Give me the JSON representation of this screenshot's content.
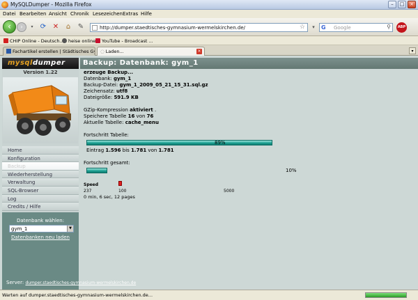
{
  "window": {
    "title": "MySQLDumper - Mozilla Firefox"
  },
  "menubar": [
    "Datei",
    "Bearbeiten",
    "Ansicht",
    "Chronik",
    "Lesezeichen",
    "Extras",
    "Hilfe"
  ],
  "navbar": {
    "url": "http://dumper.staedtisches-gymnasium-wermelskirchen.de/",
    "search_placeholder": "Google",
    "abp_label": "ABP"
  },
  "bookmarks": [
    {
      "label": "CHIP Online - Deutsch...",
      "color": "#d32020"
    },
    {
      "label": "heise online",
      "color": "#555555"
    },
    {
      "label": "YouTube - Broadcast ...",
      "color": "#c8102e"
    }
  ],
  "tabs": [
    {
      "label": "Fachartikel erstellen | Städtisches Gym...",
      "active": false
    },
    {
      "label": "Laden...",
      "active": true
    }
  ],
  "sidebar": {
    "logo_a": "mysql",
    "logo_b": "dumper",
    "version": "Version 1.22",
    "menu": [
      {
        "label": "Home",
        "active": false
      },
      {
        "label": "Konfiguration",
        "active": false
      },
      {
        "label": "Backup",
        "active": true
      },
      {
        "label": "Wiederherstellung",
        "active": false
      },
      {
        "label": "Verwaltung",
        "active": false
      },
      {
        "label": "SQL-Browser",
        "active": false
      },
      {
        "label": "Log",
        "active": false
      },
      {
        "label": "Credits / Hilfe",
        "active": false
      }
    ],
    "db_label": "Datenbank wählen:",
    "db_selected": "gym_1",
    "db_reload": "Datenbanken neu laden",
    "server_label": "Server:",
    "server_value": "dumper.staedtisches-gymnasium-wermelskirchen.de"
  },
  "main": {
    "header": "Backup: Datenbank: gym_1",
    "creating": "erzeuge Backup...",
    "db_label": "Datenbank: ",
    "db_value": "gym_1",
    "file_label": "Backup-Datei: ",
    "file_value": "gym_1_2009_05_21_15_31.sql.gz",
    "charset_label": "Zeichensatz: ",
    "charset_value": "utf8",
    "size_label": "Dateigröße: ",
    "size_value": "591.9 KB",
    "gzip_label": "GZip-Kompression ",
    "gzip_value": "aktiviert",
    "gzip_suffix": " .",
    "save_table_a": "Speichere Tabelle ",
    "save_table_n": "16",
    "save_table_b": " von ",
    "save_table_total": "76",
    "current_table_label": "Aktuelle Tabelle: ",
    "current_table_value": "cache_menu",
    "progress_table_label": "Fortschritt Tabelle:",
    "progress_table_pct": "89%",
    "progress_table_fraction": 0.89,
    "entry_a": "Eintrag ",
    "entry_from": "1.596",
    "entry_b": " bis ",
    "entry_to": "1.781",
    "entry_c": " von ",
    "entry_total": "1.781",
    "progress_total_label": "Fortschritt gesamt:",
    "progress_total_pct": "10%",
    "progress_total_fraction": 0.1,
    "speed_label": "Speed",
    "speed_value": "237",
    "speed_min": "100",
    "speed_max": "5000",
    "elapsed": "0 min, 6 sec, 12 pages"
  },
  "status": {
    "text": "Warten auf dumper.staedtisches-gymnasium-wermelskirchen.de..."
  }
}
